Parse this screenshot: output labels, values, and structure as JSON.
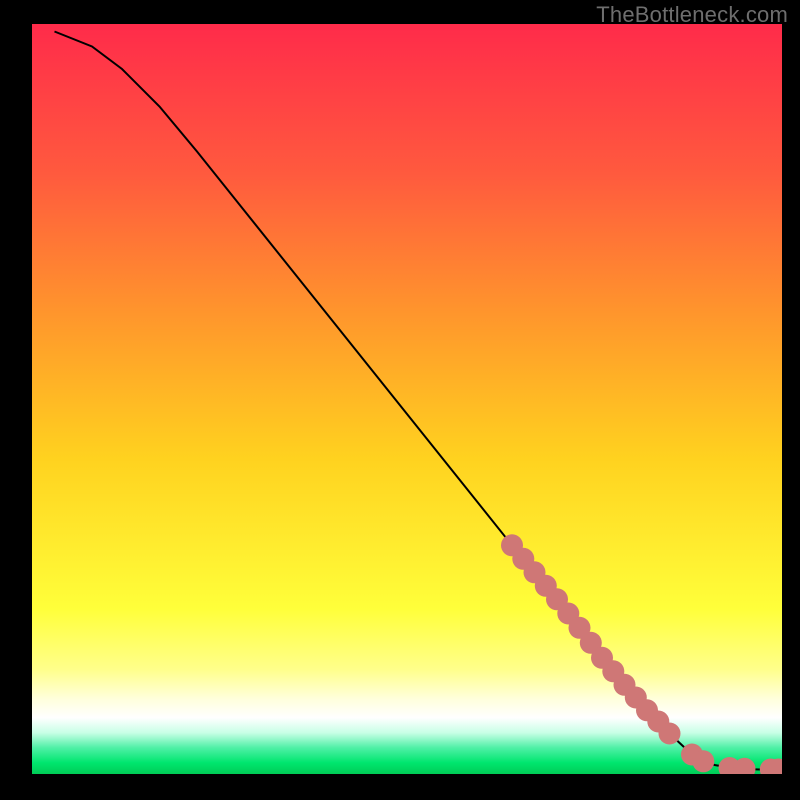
{
  "watermark": "TheBottleneck.com",
  "colors": {
    "frame": "#000000",
    "curve": "#000000",
    "marker": "#cf7776",
    "gradient_stops": [
      {
        "offset": 0.0,
        "color": "#ff2b4a"
      },
      {
        "offset": 0.2,
        "color": "#ff5a3e"
      },
      {
        "offset": 0.4,
        "color": "#ff9a2b"
      },
      {
        "offset": 0.58,
        "color": "#ffd21f"
      },
      {
        "offset": 0.78,
        "color": "#ffff3a"
      },
      {
        "offset": 0.86,
        "color": "#ffff8a"
      },
      {
        "offset": 0.9,
        "color": "#ffffdc"
      },
      {
        "offset": 0.925,
        "color": "#ffffff"
      },
      {
        "offset": 0.945,
        "color": "#c8ffe6"
      },
      {
        "offset": 0.965,
        "color": "#4ff0a6"
      },
      {
        "offset": 0.985,
        "color": "#00e66e"
      },
      {
        "offset": 1.0,
        "color": "#00cc56"
      }
    ]
  },
  "chart_data": {
    "type": "line",
    "title": "",
    "xlabel": "",
    "ylabel": "",
    "xlim": [
      0,
      100
    ],
    "ylim": [
      0,
      100
    ],
    "curve": [
      {
        "x": 3,
        "y": 99
      },
      {
        "x": 8,
        "y": 97
      },
      {
        "x": 12,
        "y": 94
      },
      {
        "x": 17,
        "y": 89
      },
      {
        "x": 22,
        "y": 83
      },
      {
        "x": 28,
        "y": 75.5
      },
      {
        "x": 34,
        "y": 68
      },
      {
        "x": 40,
        "y": 60.5
      },
      {
        "x": 46,
        "y": 53
      },
      {
        "x": 52,
        "y": 45.5
      },
      {
        "x": 58,
        "y": 38
      },
      {
        "x": 64,
        "y": 30.5
      },
      {
        "x": 70,
        "y": 23
      },
      {
        "x": 76,
        "y": 15.5
      },
      {
        "x": 81,
        "y": 9.8
      },
      {
        "x": 85,
        "y": 5.4
      },
      {
        "x": 88,
        "y": 2.6
      },
      {
        "x": 91,
        "y": 1.2
      },
      {
        "x": 94,
        "y": 0.7
      },
      {
        "x": 97,
        "y": 0.6
      },
      {
        "x": 99,
        "y": 0.6
      }
    ],
    "markers": [
      {
        "x": 64.0,
        "y": 30.5
      },
      {
        "x": 65.5,
        "y": 28.7
      },
      {
        "x": 67.0,
        "y": 26.9
      },
      {
        "x": 68.5,
        "y": 25.1
      },
      {
        "x": 70.0,
        "y": 23.3
      },
      {
        "x": 71.5,
        "y": 21.4
      },
      {
        "x": 73.0,
        "y": 19.5
      },
      {
        "x": 74.5,
        "y": 17.5
      },
      {
        "x": 76.0,
        "y": 15.5
      },
      {
        "x": 77.5,
        "y": 13.7
      },
      {
        "x": 79.0,
        "y": 11.9
      },
      {
        "x": 80.5,
        "y": 10.2
      },
      {
        "x": 82.0,
        "y": 8.5
      },
      {
        "x": 83.5,
        "y": 7.0
      },
      {
        "x": 85.0,
        "y": 5.4
      },
      {
        "x": 88.0,
        "y": 2.6
      },
      {
        "x": 89.5,
        "y": 1.7
      },
      {
        "x": 93.0,
        "y": 0.8
      },
      {
        "x": 95.0,
        "y": 0.7
      },
      {
        "x": 98.5,
        "y": 0.6
      },
      {
        "x": 99.5,
        "y": 0.6
      }
    ]
  }
}
